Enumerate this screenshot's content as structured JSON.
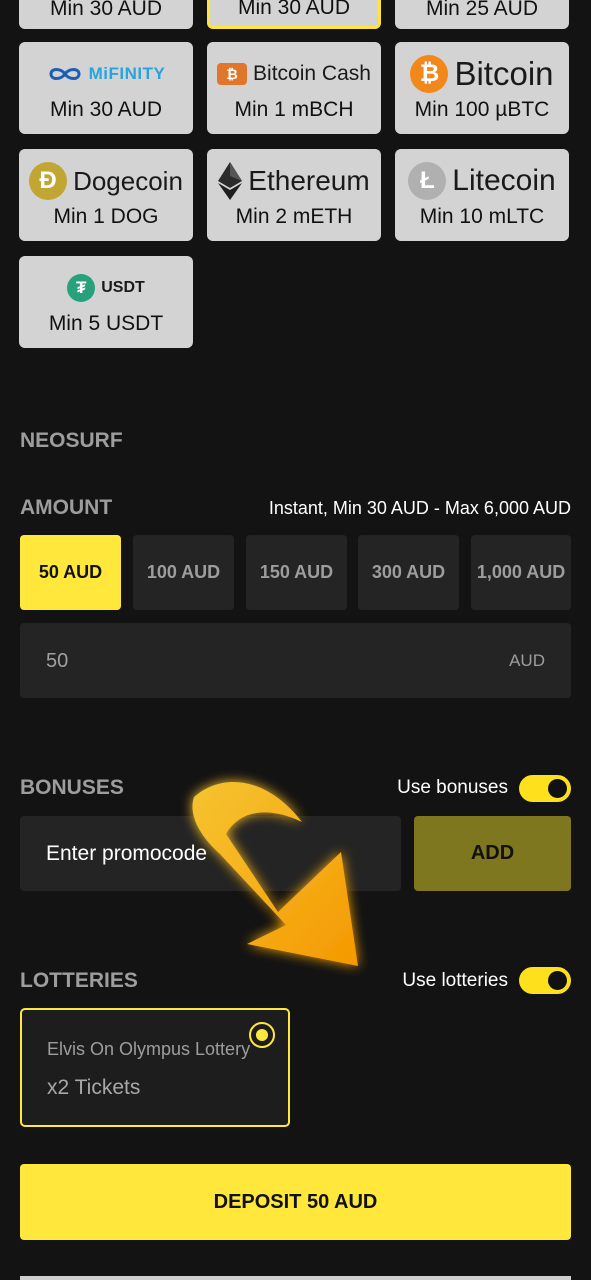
{
  "payment_methods": [
    {
      "name": "",
      "min": "Min 30 AUD"
    },
    {
      "name": "",
      "min": "Min 30 AUD"
    },
    {
      "name": "",
      "min": "Min 25 AUD"
    },
    {
      "name": "MiFINITY",
      "min": "Min 30 AUD",
      "icon": "mifinity-logo"
    },
    {
      "name": "Bitcoin Cash",
      "min": "Min 1 mBCH",
      "icon": "bitcoin-cash-icon"
    },
    {
      "name": "Bitcoin",
      "min": "Min 100 µBTC",
      "icon": "bitcoin-icon"
    },
    {
      "name": "Dogecoin",
      "min": "Min 1 DOG",
      "icon": "dogecoin-icon"
    },
    {
      "name": "Ethereum",
      "min": "Min 2 mETH",
      "icon": "ethereum-icon"
    },
    {
      "name": "Litecoin",
      "min": "Min 10 mLTC",
      "icon": "litecoin-icon"
    },
    {
      "name": "USDT",
      "min": "Min 5 USDT",
      "icon": "tether-icon"
    }
  ],
  "method_section": {
    "title": "NEOSURF"
  },
  "amount": {
    "title": "AMOUNT",
    "info": "Instant, Min 30 AUD - Max 6,000 AUD",
    "presets": [
      "50 AUD",
      "100 AUD",
      "150 AUD",
      "300 AUD",
      "1,000 AUD"
    ],
    "selected_index": 0,
    "input_value": "50",
    "currency": "AUD"
  },
  "bonuses": {
    "title": "BONUSES",
    "toggle_label": "Use bonuses",
    "toggle_on": true,
    "promo_placeholder": "Enter promocode",
    "add_label": "ADD"
  },
  "lotteries": {
    "title": "LOTTERIES",
    "toggle_label": "Use lotteries",
    "toggle_on": true,
    "card_name": "Elvis On Olympus Lottery",
    "card_tickets": "x2 Tickets"
  },
  "deposit_button": "DEPOSIT 50 AUD",
  "colors": {
    "accent": "#ffe83b",
    "background": "#131313",
    "tile": "#d3d3d3",
    "add_button": "#7f7620",
    "arrow": "#ffb000"
  }
}
